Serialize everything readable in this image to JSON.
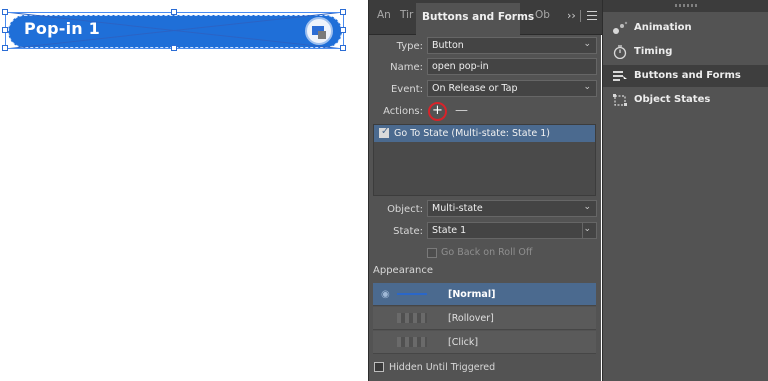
{
  "canvas": {
    "popin_label": "Pop-in 1"
  },
  "panel": {
    "tabs": [
      "An",
      "Tir",
      "Buttons and Forms",
      "Ob"
    ],
    "overflow": "››",
    "type_label": "Type:",
    "type_value": "Button",
    "name_label": "Name:",
    "name_value": "open pop-in",
    "event_label": "Event:",
    "event_value": "On Release or Tap",
    "actions_label": "Actions:",
    "plus": "+",
    "minus": "—",
    "actions": [
      {
        "text": "Go To State (Multi-state: State 1)",
        "checked": true
      }
    ],
    "object_label": "Object:",
    "object_value": "Multi-state",
    "state_label": "State:",
    "state_value": "State 1",
    "go_back_label": "Go Back on Roll Off",
    "appearance_title": "Appearance",
    "appearance": [
      "[Normal]",
      "[Rollover]",
      "[Click]"
    ],
    "hidden_label": "Hidden Until Triggered"
  },
  "right_panel": {
    "items": [
      "Animation",
      "Timing",
      "Buttons and Forms",
      "Object States"
    ]
  },
  "colors": {
    "accent": "#1f6fd8",
    "selection": "#4b6a8f",
    "highlight_circle": "#d8232a"
  }
}
